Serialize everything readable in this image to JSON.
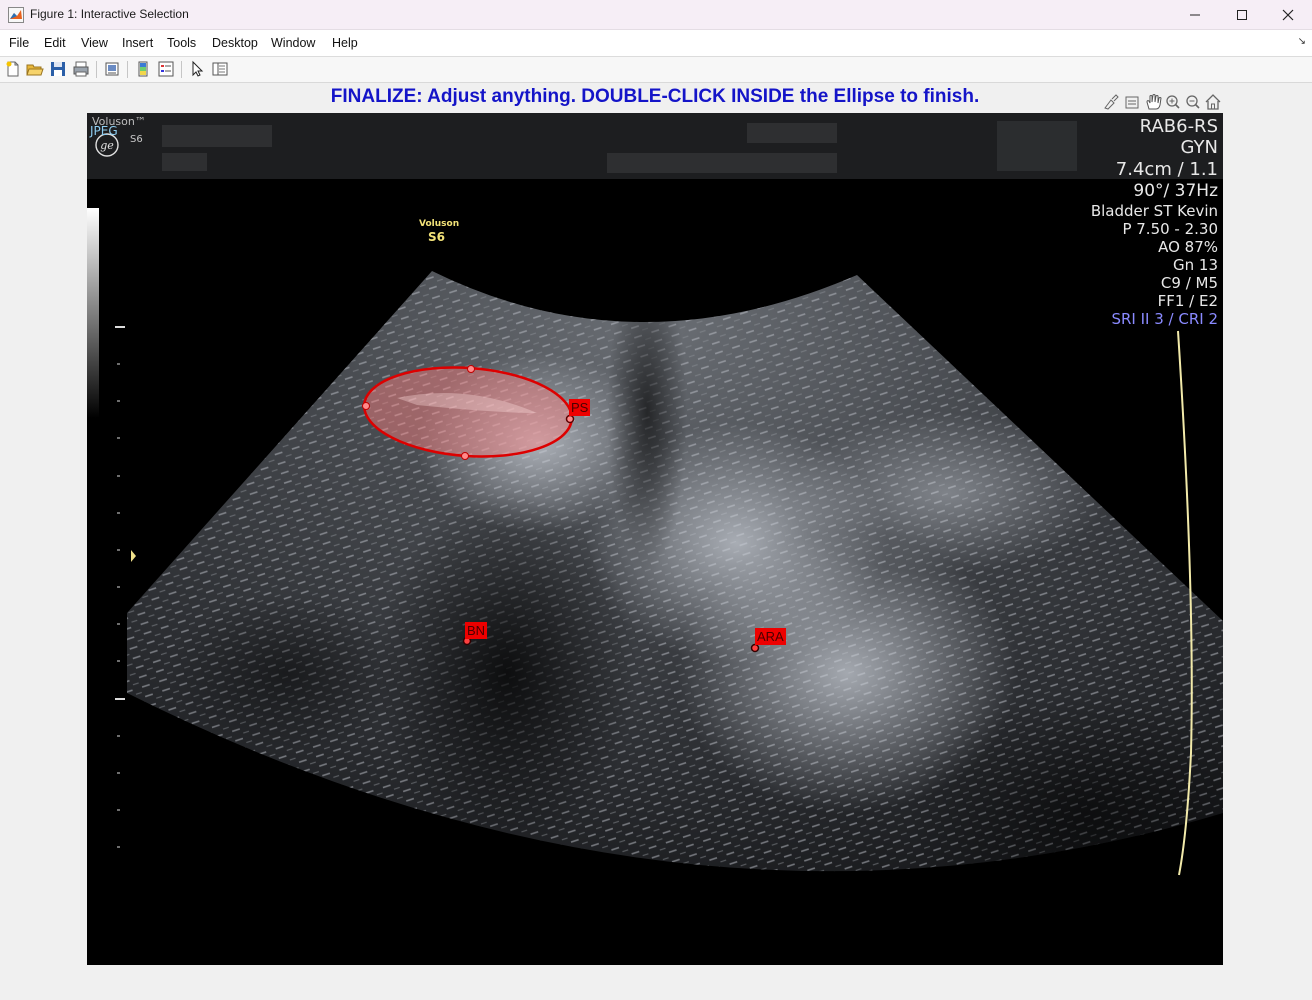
{
  "window": {
    "title": "Figure 1: Interactive Selection",
    "icon": "matlab-icon"
  },
  "menu": [
    "File",
    "Edit",
    "View",
    "Insert",
    "Tools",
    "Desktop",
    "Window",
    "Help"
  ],
  "toolbar_icons": [
    "new-figure-icon",
    "open-file-icon",
    "save-icon",
    "print-icon",
    "print-preview-icon",
    "colorbar-icon",
    "legend-icon",
    "pointer-icon",
    "property-inspector-icon"
  ],
  "axes_toolbar_icons": [
    "brush-icon",
    "data-tips-icon",
    "pan-icon",
    "zoom-in-icon",
    "zoom-out-icon",
    "home-icon"
  ],
  "instruction": "FINALIZE: Adjust anything. DOUBLE-CLICK INSIDE the Ellipse to finish.",
  "colors": {
    "instruction": "#1414c8",
    "roi": "#dd0000",
    "roi_fill": "#ff8080",
    "hud_accent": "#8a8aff",
    "depth_line": "#f2eaaa"
  },
  "ultrasound": {
    "brand": "Voluson™",
    "format": "JPEG",
    "model": "S6",
    "logo": "ge-logo",
    "watermark_brand": "Voluson",
    "watermark_model": "S6",
    "hud": {
      "probe": "RAB6-RS",
      "mode": "GYN",
      "depth": "7.4cm / 1.1",
      "angle": "90°/ 37Hz",
      "preset": "Bladder ST Kevin",
      "power": "P 7.50 - 2.30",
      "ao": "AO 87%",
      "gain": "Gn  13",
      "c": "C9 / M5",
      "ff": "FF1 / E2",
      "sri": "SRI II 3 / CRI 2"
    }
  },
  "roi": {
    "ellipse_label": "PS",
    "point_labels": [
      "BN",
      "ARA"
    ]
  }
}
